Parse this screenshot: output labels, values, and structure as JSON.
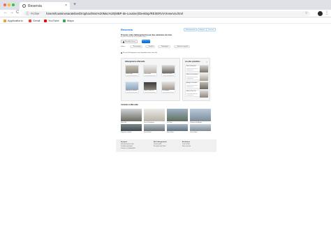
{
  "browser": {
    "tab_title": "Reservia",
    "tab_close": "×",
    "new_tab": "+",
    "nav": {
      "back": "←",
      "forward": "→",
      "reload": "C"
    },
    "address": {
      "scheme": "Fichier",
      "url": "/Users/toussinesaratelian/Dropbox/Mon%20Mac%20(MBP-de-Lousine)/Desktop/RESERVIA/reservia.html"
    },
    "star": "☆",
    "menu": "⋮"
  },
  "bookmarks": [
    {
      "label": "Applications",
      "icon": "apps-grid-icon",
      "color": "#e8a33c"
    },
    {
      "label": "Gmail",
      "icon": "gmail-icon",
      "color": "#ea4335"
    },
    {
      "label": "YouTube",
      "icon": "youtube-icon",
      "color": "#ff0000"
    },
    {
      "label": "Maps",
      "icon": "maps-icon",
      "color": "#34a853"
    }
  ],
  "site": {
    "logo": "Reservia",
    "header_buttons": [
      "Hébergements",
      "Activités",
      "S'inscrire"
    ],
    "hero": {
      "title": "Trouvez votre hébergement pour des vacances de rêve",
      "subtitle": "En plein centre-ville ou en pleine nature",
      "destination": "Marseille, France",
      "search_label": "Rechercher"
    },
    "filters": {
      "label": "Filtres",
      "chips": [
        "Économique",
        "Familial",
        "Romantique",
        "Animaux autorisés"
      ]
    },
    "compare_note": "Plus de 500 logements sont disponibles dans cette ville",
    "stays_panel": {
      "title": "Hébergements à Marseille",
      "cards": [
        "Hôtel du port",
        "Hôtel Paradis",
        "Repaire des marins",
        "Auberge la Canebière",
        "Hôtel Le Vieux Port",
        "Les Mouettes"
      ]
    },
    "popular_panel": {
      "title": "Les plus populaires",
      "close": "×",
      "cards": [
        "Hôtel Le Boulevard",
        "Hôtel Le Contemporain",
        "Auberge la Canebière",
        "Hôtel Le Vieux Port"
      ]
    },
    "activities": {
      "title": "Activités à Marseille",
      "items": [
        "Vieux Port",
        "Fort de Pomègues",
        "Le Panier",
        "Calanque de Morgiou",
        "Plage des Catalans",
        "Îles du Frioul",
        "Notre-Dame",
        "Cours Julien"
      ]
    },
    "footer": {
      "columns": [
        {
          "heading": "À propos",
          "links": [
            "Fonctionnement du site",
            "Conditions générales",
            "Données et confidentialité"
          ]
        },
        {
          "heading": "Nos hébergements",
          "links": [
            "Charte qualité",
            "Soumettre votre hôtel"
          ]
        },
        {
          "heading": "Assistance",
          "links": [
            "Centre d'aide",
            "Nous contacter"
          ]
        }
      ]
    }
  },
  "colors": {
    "accent": "#0b74e5",
    "chrome": "#dee1e6",
    "footer_bg": "#f0f0f0"
  }
}
